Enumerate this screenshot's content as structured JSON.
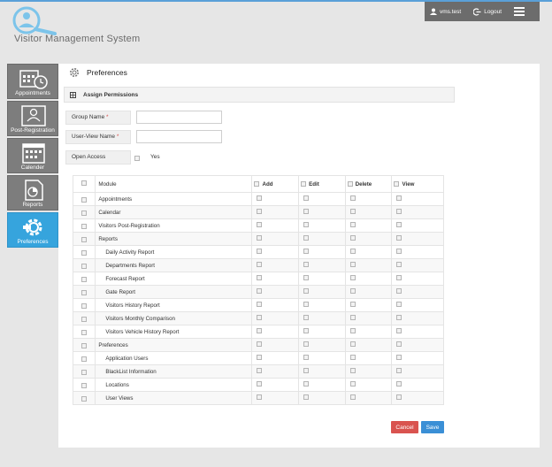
{
  "app": {
    "title": "Visitor Management System"
  },
  "topbar": {
    "user": "vms.test",
    "logout_label": "Logout"
  },
  "sidebar": {
    "items": [
      {
        "label": "Appointments",
        "icon": "calendar-clock-icon",
        "active": false
      },
      {
        "label": "Post-Registration",
        "icon": "id-card-icon",
        "active": false
      },
      {
        "label": "Calender",
        "icon": "calendar-icon",
        "active": false
      },
      {
        "label": "Reports",
        "icon": "report-icon",
        "active": false
      },
      {
        "label": "Preferences",
        "icon": "gear-icon",
        "active": true
      }
    ]
  },
  "page": {
    "title": "Preferences",
    "section_title": "Assign Permissions"
  },
  "form": {
    "group_name_label": "Group Name",
    "group_name_value": "",
    "user_view_name_label": "User-View Name",
    "user_view_name_value": "",
    "required_mark": "*",
    "open_access_label": "Open Access",
    "open_access_option": "Yes"
  },
  "table": {
    "columns": [
      "Module",
      "Add",
      "Edit",
      "Delete",
      "View"
    ],
    "rows": [
      {
        "label": "Appointments",
        "sub": false
      },
      {
        "label": "Calendar",
        "sub": false
      },
      {
        "label": "Visitors Post-Registration",
        "sub": false
      },
      {
        "label": "Reports",
        "sub": false
      },
      {
        "label": "Daily Activity Report",
        "sub": true
      },
      {
        "label": "Departments Report",
        "sub": true
      },
      {
        "label": "Forecast Report",
        "sub": true
      },
      {
        "label": "Gate Report",
        "sub": true
      },
      {
        "label": "Visitors History Report",
        "sub": true
      },
      {
        "label": "Visitors Monthly Comparison",
        "sub": true
      },
      {
        "label": "Visitors Vehicle History Report",
        "sub": true
      },
      {
        "label": "Preferences",
        "sub": false
      },
      {
        "label": "Application Users",
        "sub": true
      },
      {
        "label": "BlackList Information",
        "sub": true
      },
      {
        "label": "Locations",
        "sub": true
      },
      {
        "label": "User Views",
        "sub": true
      }
    ]
  },
  "buttons": {
    "cancel": "Cancel",
    "save": "Save"
  },
  "colors": {
    "accent": "#36a4dd",
    "sidebar_bg": "#7d7d7d",
    "cancel": "#d9534f",
    "save": "#3a8fd6",
    "topbar": "#6c6c6c"
  }
}
